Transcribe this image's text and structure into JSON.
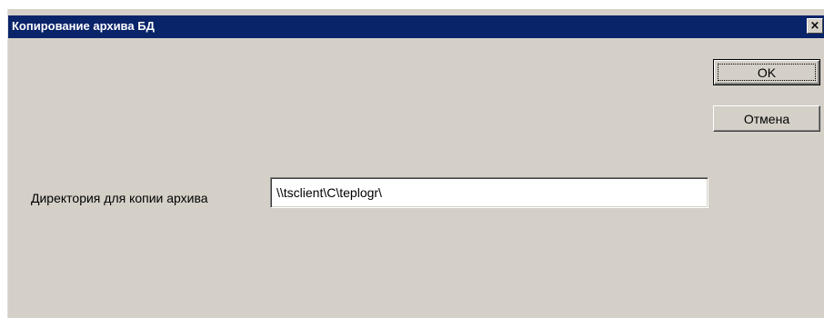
{
  "window": {
    "title": "Копирование архива БД"
  },
  "titlebar": {
    "close_label": "×"
  },
  "buttons": {
    "ok_label": "OK",
    "cancel_label": "Отмена"
  },
  "form": {
    "directory_label": "Директория для копии архива",
    "directory_value": "\\\\tsclient\\C\\teplogr\\"
  },
  "colors": {
    "titlebar": "#0a246a",
    "dialog_background": "#d4d0c8"
  }
}
